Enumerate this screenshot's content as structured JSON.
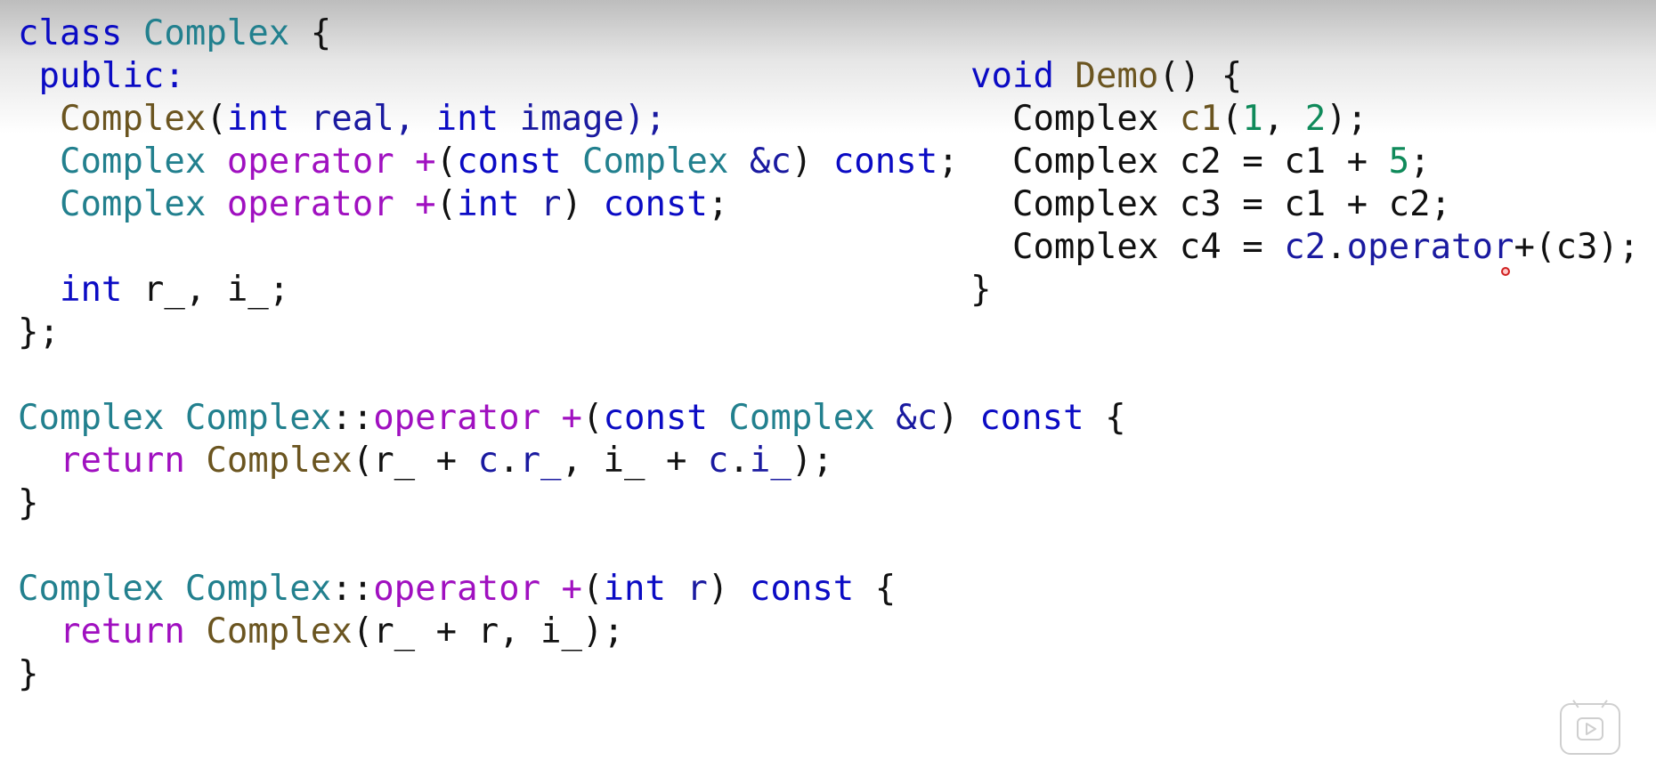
{
  "left": [
    [
      {
        "t": "class ",
        "c": "kw"
      },
      {
        "t": "Complex",
        "c": "ty"
      },
      {
        "t": " {",
        "c": ""
      }
    ],
    [
      {
        "t": " public:",
        "c": "kw"
      }
    ],
    [
      {
        "t": "  ",
        "c": ""
      },
      {
        "t": "Complex",
        "c": "fn"
      },
      {
        "t": "(",
        "c": ""
      },
      {
        "t": "int",
        "c": "kw"
      },
      {
        "t": " real, ",
        "c": "vr"
      },
      {
        "t": "int",
        "c": "kw"
      },
      {
        "t": " image);",
        "c": "vr"
      }
    ],
    [
      {
        "t": "  ",
        "c": ""
      },
      {
        "t": "Complex",
        "c": "ty"
      },
      {
        "t": " ",
        "c": ""
      },
      {
        "t": "operator +",
        "c": "op"
      },
      {
        "t": "(",
        "c": ""
      },
      {
        "t": "const",
        "c": "kw"
      },
      {
        "t": " ",
        "c": ""
      },
      {
        "t": "Complex",
        "c": "ty"
      },
      {
        "t": " &c",
        "c": "vr"
      },
      {
        "t": ") ",
        "c": ""
      },
      {
        "t": "const",
        "c": "kw"
      },
      {
        "t": ";",
        "c": ""
      }
    ],
    [
      {
        "t": "  ",
        "c": ""
      },
      {
        "t": "Complex",
        "c": "ty"
      },
      {
        "t": " ",
        "c": ""
      },
      {
        "t": "operator +",
        "c": "op"
      },
      {
        "t": "(",
        "c": ""
      },
      {
        "t": "int",
        "c": "kw"
      },
      {
        "t": " r",
        "c": "vr"
      },
      {
        "t": ") ",
        "c": ""
      },
      {
        "t": "const",
        "c": "kw"
      },
      {
        "t": ";",
        "c": ""
      }
    ],
    [
      {
        "t": "",
        "c": ""
      }
    ],
    [
      {
        "t": "  ",
        "c": ""
      },
      {
        "t": "int",
        "c": "kw"
      },
      {
        "t": " r_, i_;",
        "c": ""
      }
    ],
    [
      {
        "t": "};",
        "c": ""
      }
    ],
    [
      {
        "t": "",
        "c": ""
      }
    ],
    [
      {
        "t": "Complex",
        "c": "ty"
      },
      {
        "t": " ",
        "c": ""
      },
      {
        "t": "Complex",
        "c": "ty"
      },
      {
        "t": "::",
        "c": ""
      },
      {
        "t": "operator +",
        "c": "op"
      },
      {
        "t": "(",
        "c": ""
      },
      {
        "t": "const",
        "c": "kw"
      },
      {
        "t": " ",
        "c": ""
      },
      {
        "t": "Complex",
        "c": "ty"
      },
      {
        "t": " &c",
        "c": "vr"
      },
      {
        "t": ") ",
        "c": ""
      },
      {
        "t": "const",
        "c": "kw"
      },
      {
        "t": " {",
        "c": ""
      }
    ],
    [
      {
        "t": "  ",
        "c": ""
      },
      {
        "t": "return",
        "c": "op"
      },
      {
        "t": " ",
        "c": ""
      },
      {
        "t": "Complex",
        "c": "fn"
      },
      {
        "t": "(r_ + ",
        "c": ""
      },
      {
        "t": "c",
        "c": "vr"
      },
      {
        "t": ".",
        "c": ""
      },
      {
        "t": "r_",
        "c": "vr"
      },
      {
        "t": ", i_ + ",
        "c": ""
      },
      {
        "t": "c",
        "c": "vr"
      },
      {
        "t": ".",
        "c": ""
      },
      {
        "t": "i_",
        "c": "vr"
      },
      {
        "t": ");",
        "c": ""
      }
    ],
    [
      {
        "t": "}",
        "c": ""
      }
    ],
    [
      {
        "t": "",
        "c": ""
      }
    ],
    [
      {
        "t": "Complex",
        "c": "ty"
      },
      {
        "t": " ",
        "c": ""
      },
      {
        "t": "Complex",
        "c": "ty"
      },
      {
        "t": "::",
        "c": ""
      },
      {
        "t": "operator +",
        "c": "op"
      },
      {
        "t": "(",
        "c": ""
      },
      {
        "t": "int",
        "c": "kw"
      },
      {
        "t": " r",
        "c": "vr"
      },
      {
        "t": ") ",
        "c": ""
      },
      {
        "t": "const",
        "c": "kw"
      },
      {
        "t": " {",
        "c": ""
      }
    ],
    [
      {
        "t": "  ",
        "c": ""
      },
      {
        "t": "return",
        "c": "op"
      },
      {
        "t": " ",
        "c": ""
      },
      {
        "t": "Complex",
        "c": "fn"
      },
      {
        "t": "(r_ + r, i_);",
        "c": ""
      }
    ],
    [
      {
        "t": "}",
        "c": ""
      }
    ]
  ],
  "right": [
    [
      {
        "t": "void",
        "c": "kw"
      },
      {
        "t": " ",
        "c": ""
      },
      {
        "t": "Demo",
        "c": "fn"
      },
      {
        "t": "() {",
        "c": ""
      }
    ],
    [
      {
        "t": "  Complex ",
        "c": ""
      },
      {
        "t": "c1",
        "c": "fn"
      },
      {
        "t": "(",
        "c": ""
      },
      {
        "t": "1",
        "c": "nm"
      },
      {
        "t": ", ",
        "c": ""
      },
      {
        "t": "2",
        "c": "nm"
      },
      {
        "t": ");",
        "c": ""
      }
    ],
    [
      {
        "t": "  Complex c2 = c1 + ",
        "c": ""
      },
      {
        "t": "5",
        "c": "nm"
      },
      {
        "t": ";",
        "c": ""
      }
    ],
    [
      {
        "t": "  Complex c3 = c1 + c2;",
        "c": ""
      }
    ],
    [
      {
        "t": "  Complex c4 = ",
        "c": ""
      },
      {
        "t": "c2",
        "c": "vr"
      },
      {
        "t": ".",
        "c": ""
      },
      {
        "t": "operator",
        "c": "vr"
      },
      {
        "t": "+(c3);",
        "c": ""
      }
    ],
    [
      {
        "t": "}",
        "c": ""
      }
    ]
  ],
  "colors": {
    "keyword": "#0b0bc4",
    "type": "#22808e",
    "function": "#6b5520",
    "operator": "#a010c0",
    "number": "#0f8a5a",
    "variable": "#1a1aa0"
  },
  "icons": {
    "play": "play-icon",
    "cursor": "cursor-dot-icon"
  }
}
